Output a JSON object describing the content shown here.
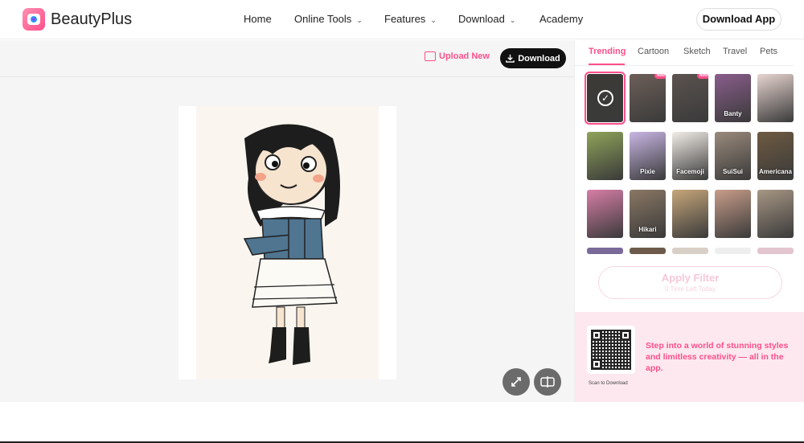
{
  "header": {
    "brand": "BeautyPlus",
    "nav": [
      {
        "label": "Home",
        "dropdown": false
      },
      {
        "label": "Online Tools",
        "dropdown": true
      },
      {
        "label": "Features",
        "dropdown": true
      },
      {
        "label": "Download",
        "dropdown": true
      },
      {
        "label": "Academy",
        "dropdown": false
      }
    ],
    "download_app": "Download App"
  },
  "workspace": {
    "upload_label": "Upload New",
    "download_label": "Download"
  },
  "panel": {
    "tabs": [
      "Trending",
      "Cartoon",
      "Sketch",
      "Travel",
      "Pets"
    ],
    "active_tab": "Trending",
    "filters": [
      {
        "label": "",
        "new": false,
        "selected": true,
        "color": "#3b3a36"
      },
      {
        "label": "",
        "new": true,
        "selected": false,
        "color": "#6d5f58"
      },
      {
        "label": "",
        "new": true,
        "selected": false,
        "color": "#5b534f"
      },
      {
        "label": "Banty",
        "new": false,
        "selected": false,
        "color": "#8a5d8c"
      },
      {
        "label": "",
        "new": false,
        "selected": false,
        "color": "#e8d5d0"
      },
      {
        "label": "",
        "new": false,
        "selected": false,
        "color": "#8fa35a"
      },
      {
        "label": "Pixie",
        "new": false,
        "selected": false,
        "color": "#c9b6e4"
      },
      {
        "label": "Facemoji",
        "new": false,
        "selected": false,
        "color": "#f2ede7"
      },
      {
        "label": "SuiSui",
        "new": false,
        "selected": false,
        "color": "#9a8a7c"
      },
      {
        "label": "Americana",
        "new": false,
        "selected": false,
        "color": "#6e5a41"
      },
      {
        "label": "",
        "new": false,
        "selected": false,
        "color": "#d77ea6"
      },
      {
        "label": "Hikari",
        "new": false,
        "selected": false,
        "color": "#8a7764"
      },
      {
        "label": "",
        "new": false,
        "selected": false,
        "color": "#c6a67a"
      },
      {
        "label": "",
        "new": false,
        "selected": false,
        "color": "#c89d89"
      },
      {
        "label": "",
        "new": false,
        "selected": false,
        "color": "#a79784"
      }
    ],
    "apply_label": "Apply Filter",
    "apply_sub": "0 Time Left Today",
    "promo_text": "Step into a world of stunning styles and limitless creativity — all in the app.",
    "scan_label": "Scan to Download"
  },
  "colors": {
    "accent": "#ff4f8a",
    "dark": "#111111"
  }
}
